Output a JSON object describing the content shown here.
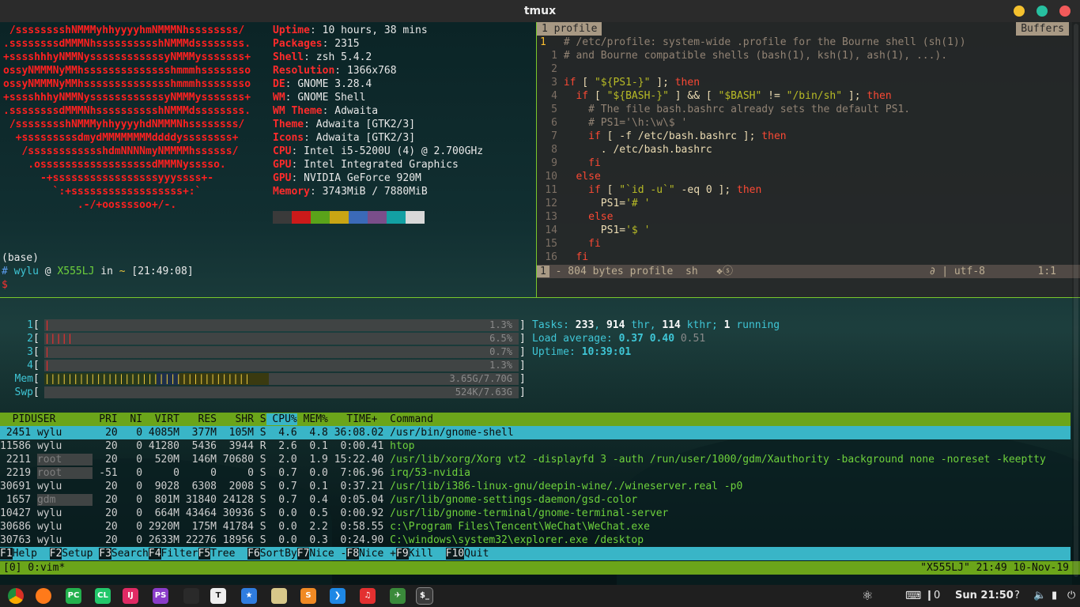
{
  "window": {
    "title": "tmux"
  },
  "colors": {
    "accent_green": "#79c82b",
    "htop_cyan": "#39b5c7",
    "titlebar_yellow": "#f4c12e",
    "titlebar_green": "#27c0a0",
    "titlebar_red": "#f25a5a"
  },
  "neofetch": {
    "logo": [
      " /sssssssshNMMMyhhyyyyhmNMMMNhssssssss/",
      ".ssssssssdMMMNhsssssssssshNMMMdssssssss.",
      "+sssshhhyNMMNyssssssssssssyNMMMysssssss+",
      "ossyNMMMNyMMhsssssssssssssshmmmhssssssso",
      "ossyNMMMNyMMhsssssssssssssshmmmhssssssso",
      "+sssshhhyNMMNyssssssssssssyNMMMysssssss+",
      ".ssssssssdMMMNhsssssssssshNMMMdssssssss.",
      " /sssssssshNMMMyhhyyyyhdNMMMNhssssssss/",
      "  +sssssssssdmydMMMMMMMMddddyssssssss+",
      "   /sssssssssssshdmNNNNmyNMMMMhssssss/",
      "    .ossssssssssssssssssdMMMNysssso.",
      "      -+sssssssssssssssssyyyssss+-",
      "        `:+ssssssssssssssssss+:`",
      "            .-/+oossssoo+/-."
    ],
    "info": [
      {
        "key": "Uptime",
        "value": "10 hours, 38 mins"
      },
      {
        "key": "Packages",
        "value": "2315"
      },
      {
        "key": "Shell",
        "value": "zsh 5.4.2"
      },
      {
        "key": "Resolution",
        "value": "1366x768"
      },
      {
        "key": "DE",
        "value": "GNOME 3.28.4"
      },
      {
        "key": "WM",
        "value": "GNOME Shell"
      },
      {
        "key": "WM Theme",
        "value": "Adwaita"
      },
      {
        "key": "Theme",
        "value": "Adwaita [GTK2/3]"
      },
      {
        "key": "Icons",
        "value": "Adwaita [GTK2/3]"
      },
      {
        "key": "CPU",
        "value": "Intel i5-5200U (4) @ 2.700GHz"
      },
      {
        "key": "GPU",
        "value": "Intel Integrated Graphics"
      },
      {
        "key": "GPU",
        "value": "NVIDIA GeForce 920M"
      },
      {
        "key": "Memory",
        "value": "3743MiB / 7880MiB"
      }
    ],
    "swatches": [
      "#3a3a3a",
      "#cc1a1a",
      "#5aa31a",
      "#c9a514",
      "#3b6ab8",
      "#7a4e8a",
      "#13a0a3",
      "#d8d8d8"
    ],
    "prompt": {
      "env": "(base)",
      "hash": "#",
      "user": "wylu",
      "at": "@",
      "host": "X555LJ",
      "in": "in",
      "dir": "~",
      "time": "[21:49:08]",
      "symbol": "$"
    }
  },
  "vim": {
    "tab_label": "1 profile",
    "buffers_label": "Buffers",
    "lines": [
      {
        "n": "1",
        "text": "# /etc/profile: system-wide .profile for the Bourne shell (sh(1))"
      },
      {
        "n": "1",
        "text": "# and Bourne compatible shells (bash(1), ksh(1), ash(1), ...)."
      },
      {
        "n": "2",
        "text": ""
      },
      {
        "n": "3",
        "text": "if [ \"${PS1-}\" ]; then"
      },
      {
        "n": "4",
        "text": "  if [ \"${BASH-}\" ] && [ \"$BASH\" != \"/bin/sh\" ]; then"
      },
      {
        "n": "5",
        "text": "    # The file bash.bashrc already sets the default PS1."
      },
      {
        "n": "6",
        "text": "    # PS1='\\h:\\w\\$ '"
      },
      {
        "n": "7",
        "text": "    if [ -f /etc/bash.bashrc ]; then"
      },
      {
        "n": "8",
        "text": "      . /etc/bash.bashrc"
      },
      {
        "n": "9",
        "text": "    fi"
      },
      {
        "n": "10",
        "text": "  else"
      },
      {
        "n": "11",
        "text": "    if [ \"`id -u`\" -eq 0 ]; then"
      },
      {
        "n": "12",
        "text": "      PS1='# '"
      },
      {
        "n": "13",
        "text": "    else"
      },
      {
        "n": "14",
        "text": "      PS1='$ '"
      },
      {
        "n": "15",
        "text": "    fi"
      },
      {
        "n": "16",
        "text": "  fi"
      }
    ],
    "status": {
      "num": "1",
      "info": "- 804 bytes profile",
      "ft": "sh",
      "mid": "❖ⓢ",
      "enc": "∂ | utf-8",
      "pos": "1:1"
    }
  },
  "htop": {
    "meters": [
      {
        "label": "1",
        "value": "1.3%",
        "fraction": 0.013
      },
      {
        "label": "2",
        "value": "6.5%",
        "fraction": 0.065
      },
      {
        "label": "3",
        "value": "0.7%",
        "fraction": 0.007
      },
      {
        "label": "4",
        "value": "1.3%",
        "fraction": 0.013
      },
      {
        "label": "Mem",
        "value": "3.65G/7.70G",
        "fraction": 0.474
      },
      {
        "label": "Swp",
        "value": "524K/7.63G",
        "fraction": 0.0
      }
    ],
    "tasks_label": "Tasks:",
    "tasks": "233",
    "thr": "914",
    "thr_label": "thr,",
    "kthr": "114",
    "kthr_label": "kthr;",
    "running": "1",
    "running_label": "running",
    "load_label": "Load average:",
    "load1": "0.37",
    "load5": "0.40",
    "load15": "0.51",
    "uptime_label": "Uptime:",
    "uptime": "10:39:01",
    "header": [
      "  PID",
      "USER     ",
      "  PRI",
      "  NI",
      "  VIRT",
      "   RES",
      "   SHR",
      " S",
      " CPU%",
      " MEM%",
      "   TIME+ ",
      " Command"
    ],
    "processes": [
      {
        "pid": "2451",
        "user": "wylu",
        "pri": "20",
        "ni": "0",
        "virt": "4085M",
        "res": "377M",
        "shr": "105M",
        "s": "S",
        "cpu": "4.6",
        "mem": "4.8",
        "time": "36:08.02",
        "cmd": "/usr/bin/gnome-shell"
      },
      {
        "pid": "11586",
        "user": "wylu",
        "pri": "20",
        "ni": "0",
        "virt": "41280",
        "res": "5436",
        "shr": "3944",
        "s": "R",
        "cpu": "2.6",
        "mem": "0.1",
        "time": "0:00.41",
        "cmd": "htop"
      },
      {
        "pid": "2211",
        "user": "root",
        "pri": "20",
        "ni": "0",
        "virt": "520M",
        "res": "146M",
        "shr": "70680",
        "s": "S",
        "cpu": "2.0",
        "mem": "1.9",
        "time": "15:22.40",
        "cmd": "/usr/lib/xorg/Xorg vt2 -displayfd 3 -auth /run/user/1000/gdm/Xauthority -background none -noreset -keeptty"
      },
      {
        "pid": "2219",
        "user": "root",
        "pri": "-51",
        "ni": "0",
        "virt": "0",
        "res": "0",
        "shr": "0",
        "s": "S",
        "cpu": "0.7",
        "mem": "0.0",
        "time": "7:06.96",
        "cmd": "irq/53-nvidia"
      },
      {
        "pid": "30691",
        "user": "wylu",
        "pri": "20",
        "ni": "0",
        "virt": "9028",
        "res": "6308",
        "shr": "2008",
        "s": "S",
        "cpu": "0.7",
        "mem": "0.1",
        "time": "0:37.21",
        "cmd": "/usr/lib/i386-linux-gnu/deepin-wine/./wineserver.real -p0"
      },
      {
        "pid": "1657",
        "user": "gdm",
        "pri": "20",
        "ni": "0",
        "virt": "801M",
        "res": "31840",
        "shr": "24128",
        "s": "S",
        "cpu": "0.7",
        "mem": "0.4",
        "time": "0:05.04",
        "cmd": "/usr/lib/gnome-settings-daemon/gsd-color"
      },
      {
        "pid": "10427",
        "user": "wylu",
        "pri": "20",
        "ni": "0",
        "virt": "664M",
        "res": "43464",
        "shr": "30936",
        "s": "S",
        "cpu": "0.0",
        "mem": "0.5",
        "time": "0:00.92",
        "cmd": "/usr/lib/gnome-terminal/gnome-terminal-server"
      },
      {
        "pid": "30686",
        "user": "wylu",
        "pri": "20",
        "ni": "0",
        "virt": "2920M",
        "res": "175M",
        "shr": "41784",
        "s": "S",
        "cpu": "0.0",
        "mem": "2.2",
        "time": "0:58.55",
        "cmd": "c:\\Program Files\\Tencent\\WeChat\\WeChat.exe"
      },
      {
        "pid": "30763",
        "user": "wylu",
        "pri": "20",
        "ni": "0",
        "virt": "2633M",
        "res": "22276",
        "shr": "18956",
        "s": "S",
        "cpu": "0.0",
        "mem": "0.3",
        "time": "0:24.90",
        "cmd": "C:\\windows\\system32\\explorer.exe /desktop"
      }
    ],
    "fkeys": [
      {
        "key": "F1",
        "label": "Help  "
      },
      {
        "key": "F2",
        "label": "Setup "
      },
      {
        "key": "F3",
        "label": "Search"
      },
      {
        "key": "F4",
        "label": "Filter"
      },
      {
        "key": "F5",
        "label": "Tree  "
      },
      {
        "key": "F6",
        "label": "SortBy"
      },
      {
        "key": "F7",
        "label": "Nice -"
      },
      {
        "key": "F8",
        "label": "Nice +"
      },
      {
        "key": "F9",
        "label": "Kill  "
      },
      {
        "key": "F10",
        "label": "Quit"
      }
    ]
  },
  "tmux": {
    "left": "[0] 0:vim*",
    "right": "\"X555LJ\" 21:49 10-Nov-19"
  },
  "dock": {
    "apps": [
      {
        "name": "chrome-icon",
        "glyph": ""
      },
      {
        "name": "firefox-icon",
        "glyph": ""
      },
      {
        "name": "pycharm-icon",
        "glyph": "PC"
      },
      {
        "name": "clion-icon",
        "glyph": "CL"
      },
      {
        "name": "intellij-icon",
        "glyph": "IJ"
      },
      {
        "name": "phpstorm-icon",
        "glyph": "PS"
      },
      {
        "name": "qq-icon",
        "glyph": ""
      },
      {
        "name": "typora-icon",
        "glyph": "T"
      },
      {
        "name": "starred-icon",
        "glyph": "★"
      },
      {
        "name": "files-icon",
        "glyph": ""
      },
      {
        "name": "sublime-icon",
        "glyph": "S"
      },
      {
        "name": "vscode-icon",
        "glyph": "❯"
      },
      {
        "name": "netease-music-icon",
        "glyph": "♫"
      },
      {
        "name": "ssr-icon",
        "glyph": "✈"
      },
      {
        "name": "terminal-icon",
        "glyph": "$_"
      }
    ],
    "tray": {
      "notif_count": "0",
      "clock": "Sun 21:50"
    }
  }
}
